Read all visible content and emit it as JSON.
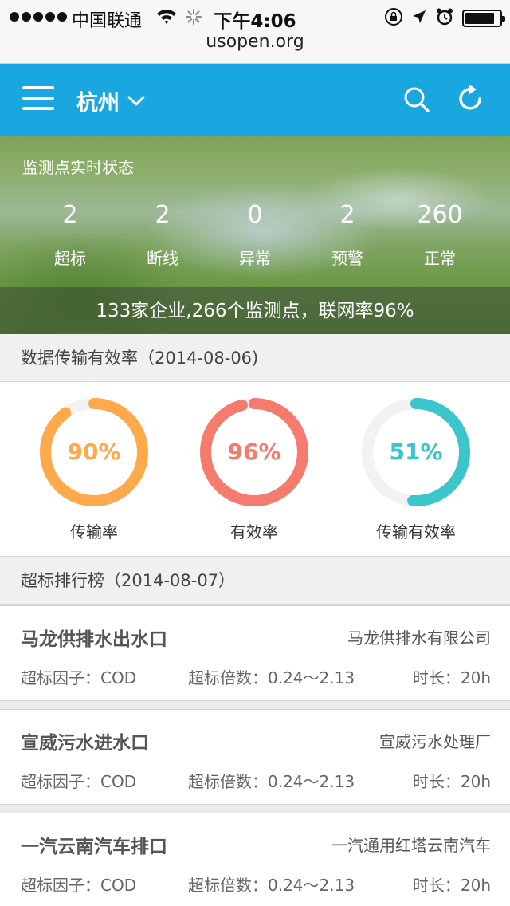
{
  "status_bar": {
    "carrier": "中国联通",
    "time": "下午4:06",
    "battery_level": 0.85
  },
  "browser": {
    "url": "usopen.org"
  },
  "header": {
    "city": "杭州",
    "icons": [
      "menu-icon",
      "chevron-down-icon",
      "search-icon",
      "refresh-icon"
    ]
  },
  "hero": {
    "title": "监测点实时状态",
    "stats": [
      {
        "value": "2",
        "label": "超标"
      },
      {
        "value": "2",
        "label": "断线"
      },
      {
        "value": "0",
        "label": "异常"
      },
      {
        "value": "2",
        "label": "预警"
      },
      {
        "value": "260",
        "label": "正常"
      }
    ],
    "summary": "133家企业,266个监测点，联网率96%"
  },
  "efficiency": {
    "heading": "数据传输有效率（2014-08-06)",
    "rings": [
      {
        "percent": 90,
        "text": "90%",
        "label": "传输率",
        "color": "#ffa94d"
      },
      {
        "percent": 96,
        "text": "96%",
        "label": "有效率",
        "color": "#f47b6e"
      },
      {
        "percent": 51,
        "text": "51%",
        "label": "传输有效率",
        "color": "#3cc6cc"
      }
    ],
    "track_color": "#f2f2f2"
  },
  "ranking": {
    "heading": "超标排行榜（2014-08-07）",
    "items": [
      {
        "name": "马龙供排水出水口",
        "company": "马龙供排水有限公司",
        "factor": "超标因子：COD",
        "multiple": "超标倍数：0.24～2.13",
        "duration": "时长：20h"
      },
      {
        "name": "宣威污水进水口",
        "company": "宣威污水处理厂",
        "factor": "超标因子：COD",
        "multiple": "超标倍数：0.24～2.13",
        "duration": "时长：20h"
      },
      {
        "name": "一汽云南汽车排口",
        "company": "一汽通用红塔云南汽车",
        "factor": "超标因子：COD",
        "multiple": "超标倍数：0.24～2.13",
        "duration": "时长：20h"
      }
    ]
  },
  "colors": {
    "header": "#1aa7e0"
  }
}
